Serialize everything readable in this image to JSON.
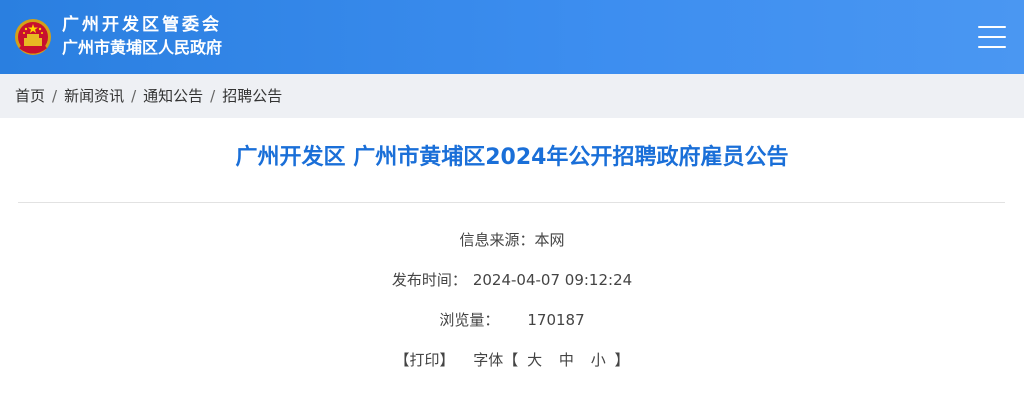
{
  "header": {
    "org_line1": "广州开发区管委会",
    "org_line2": "广州市黄埔区人民政府",
    "emblem_icon": "national-emblem-icon",
    "menu_icon": "hamburger-menu-icon",
    "bg_color": "#3a8bee"
  },
  "breadcrumb": {
    "items": [
      "首页",
      "新闻资讯",
      "通知公告",
      "招聘公告"
    ],
    "separator": "/"
  },
  "article": {
    "title": "广州开发区 广州市黄埔区2024年公开招聘政府雇员公告",
    "source_label": "信息来源：",
    "source_value": "本网",
    "date_label": "发布时间：",
    "date_value": "2024-04-07 09:12:24",
    "views_label": "浏览量：",
    "views_value": "170187",
    "print_label": "【打印】",
    "font_label": "字体【",
    "font_large": "大",
    "font_medium": "中",
    "font_small": "小",
    "font_close": "】",
    "title_color": "#1a6fd8"
  }
}
